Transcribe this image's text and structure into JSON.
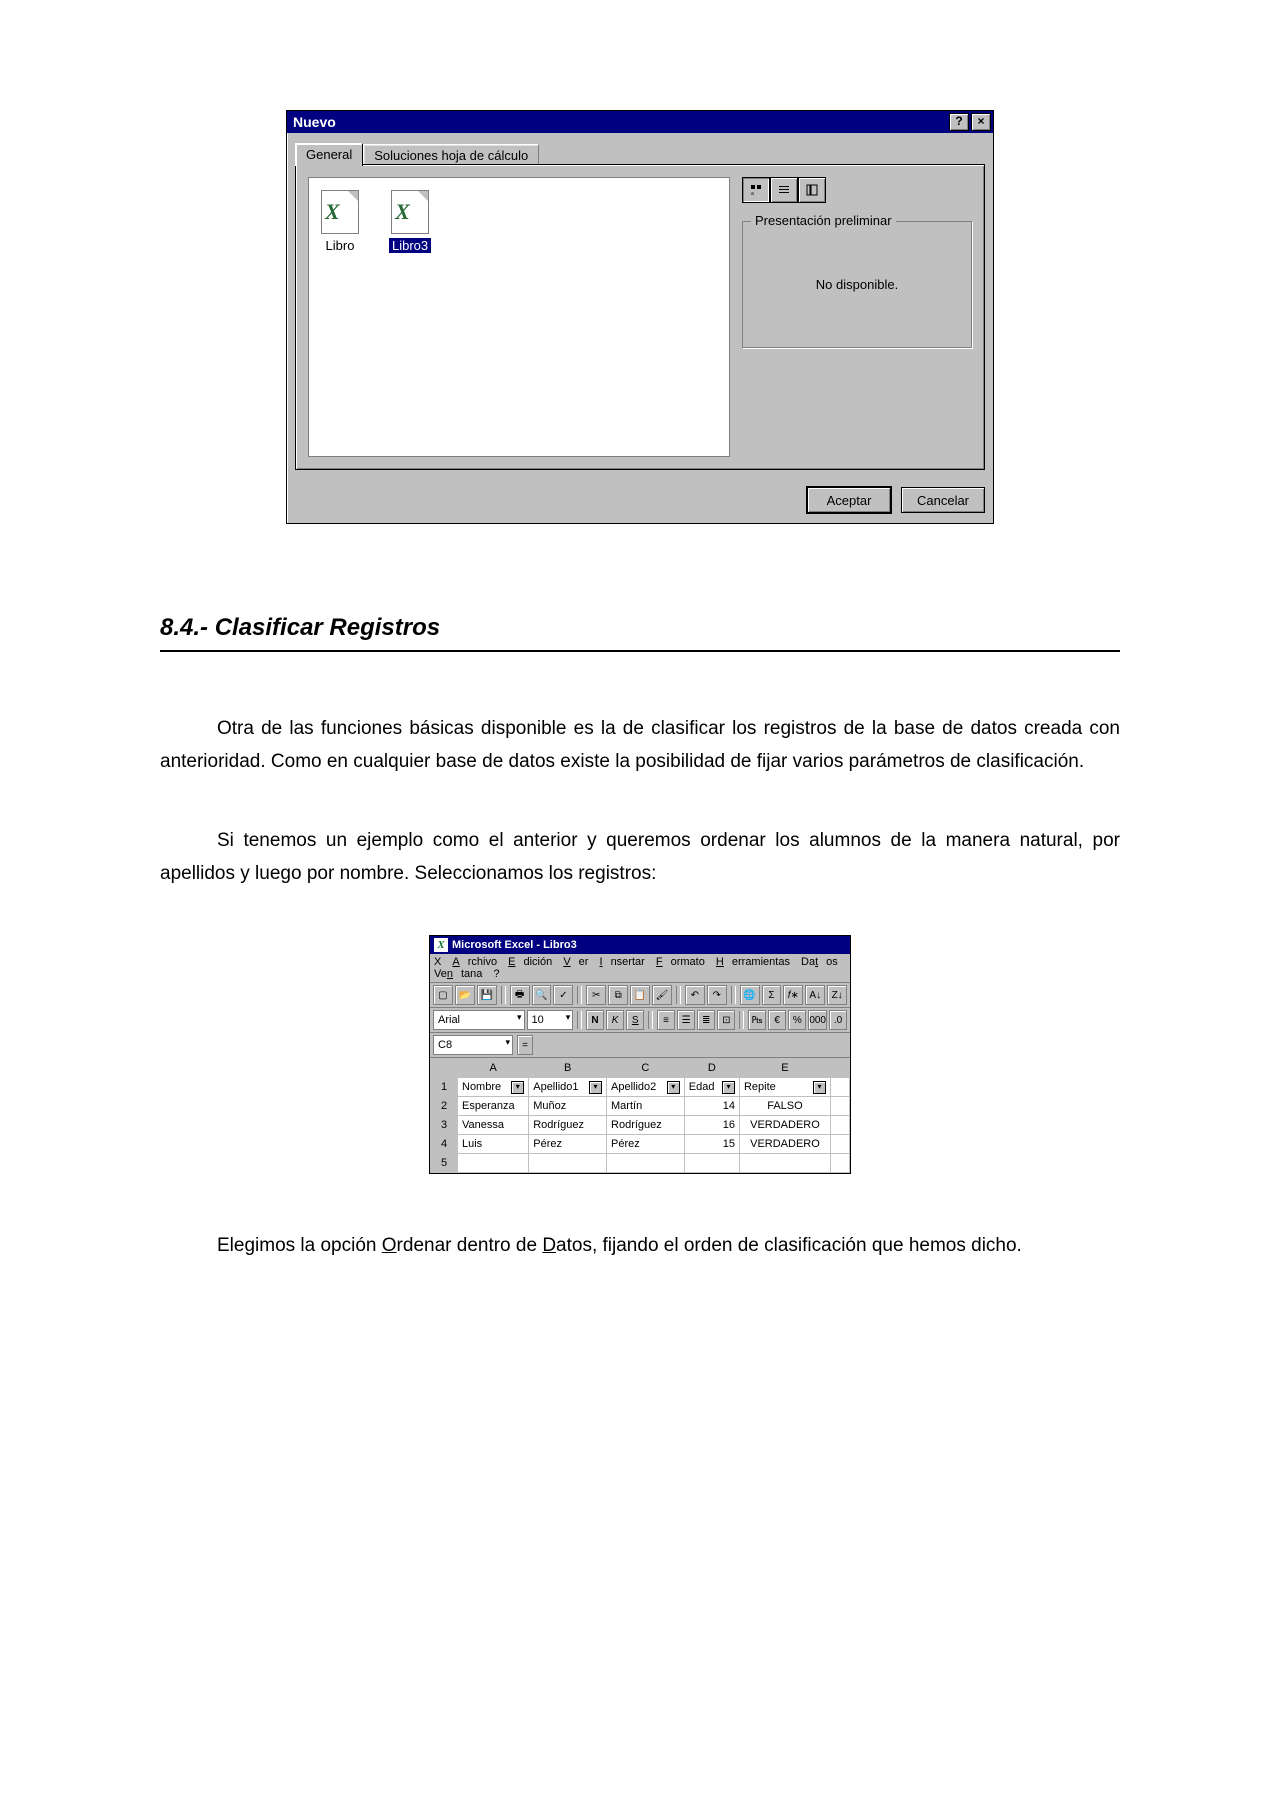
{
  "dialog": {
    "title": "Nuevo",
    "help_btn": "?",
    "close_btn": "×",
    "tabs": {
      "general": "General",
      "soluciones": "Soluciones hoja de cálculo"
    },
    "files": {
      "libro": "Libro",
      "libro3": "Libro3"
    },
    "preview_group": "Presentación preliminar",
    "preview_msg": "No disponible.",
    "accept": "Aceptar",
    "cancel": "Cancelar"
  },
  "section": {
    "heading": "8.4.- Clasificar Registros",
    "para1": "Otra de las funciones básicas disponible es la de clasificar los registros de la base de datos creada con anterioridad. Como en cualquier base de datos existe la posibilidad de fijar varios parámetros de clasificación.",
    "para2": "Si tenemos un ejemplo como el anterior y queremos ordenar los alumnos de la manera natural, por apellidos y luego por nombre. Seleccionamos los registros:",
    "para3_a": "Elegimos la opción ",
    "para3_o": "O",
    "para3_b": "rdenar dentro de ",
    "para3_d": "D",
    "para3_c": "atos, fijando el orden de clasificación que hemos dicho."
  },
  "excel": {
    "title": "Microsoft Excel - Libro3",
    "menus": {
      "archivo": "Archivo",
      "edicion": "Edición",
      "ver": "Ver",
      "insertar": "Insertar",
      "formato": "Formato",
      "herramientas": "Herramientas",
      "datos": "Datos",
      "ventana": "Ventana",
      "ayuda": "?"
    },
    "font": "Arial",
    "size": "10",
    "namebox": "C8",
    "formula": "=",
    "cols": [
      "A",
      "B",
      "C",
      "D",
      "E"
    ],
    "headers": {
      "a": "Nombre",
      "b": "Apellido1",
      "c": "Apellido2",
      "d": "Edad",
      "e": "Repite"
    },
    "rows": [
      {
        "n": "1",
        "a": "Nombre",
        "b": "Apellido1",
        "c": "Apellido2",
        "d": "Edad",
        "e": "Repite"
      },
      {
        "n": "2",
        "a": "Esperanza",
        "b": "Muñoz",
        "c": "Martín",
        "d": "14",
        "e": "FALSO"
      },
      {
        "n": "3",
        "a": "Vanessa",
        "b": "Rodríguez",
        "c": "Rodríguez",
        "d": "16",
        "e": "VERDADERO"
      },
      {
        "n": "4",
        "a": "Luis",
        "b": "Pérez",
        "c": "Pérez",
        "d": "15",
        "e": "VERDADERO"
      },
      {
        "n": "5",
        "a": "",
        "b": "",
        "c": "",
        "d": "",
        "e": ""
      }
    ]
  }
}
